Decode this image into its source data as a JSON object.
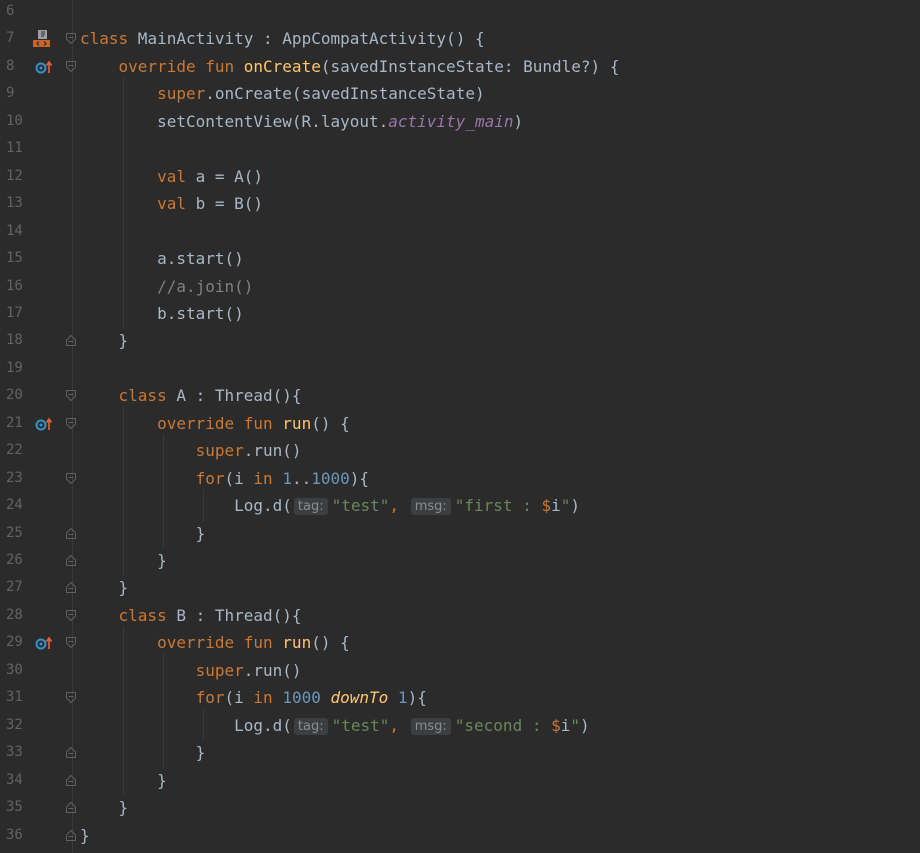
{
  "editor": {
    "colors": {
      "background": "#2b2b2b",
      "line_number": "#606366",
      "keyword": "#cc7832",
      "function_decl": "#ffc66d",
      "constant_italic": "#9876aa",
      "number": "#6897bb",
      "string": "#6a8759",
      "comment": "#808080",
      "default_text": "#a9b7c6"
    },
    "lines": [
      {
        "num": "6",
        "gutter": [],
        "segs": []
      },
      {
        "num": "7",
        "gutter": [
          "class-marker-icon",
          "fold-open-icon"
        ],
        "segs": [
          [
            "kw",
            "class"
          ],
          [
            "t",
            " MainActivity : AppCompatActivity() {"
          ]
        ]
      },
      {
        "num": "8",
        "gutter": [
          "override-icon",
          "fold-open-icon"
        ],
        "segs": [
          [
            "t",
            "    "
          ],
          [
            "kw",
            "override fun "
          ],
          [
            "fn",
            "onCreate"
          ],
          [
            "t",
            "(savedInstanceState: Bundle?) {"
          ]
        ]
      },
      {
        "num": "9",
        "gutter": [],
        "segs": [
          [
            "t",
            "        "
          ],
          [
            "kw",
            "super"
          ],
          [
            "t",
            ".onCreate(savedInstanceState)"
          ]
        ]
      },
      {
        "num": "10",
        "gutter": [],
        "segs": [
          [
            "t",
            "        setContentView(R.layout."
          ],
          [
            "ital",
            "activity_main"
          ],
          [
            "t",
            ")"
          ]
        ]
      },
      {
        "num": "11",
        "gutter": [],
        "segs": []
      },
      {
        "num": "12",
        "gutter": [],
        "segs": [
          [
            "t",
            "        "
          ],
          [
            "kw",
            "val"
          ],
          [
            "t",
            " a = A()"
          ]
        ]
      },
      {
        "num": "13",
        "gutter": [],
        "segs": [
          [
            "t",
            "        "
          ],
          [
            "kw",
            "val"
          ],
          [
            "t",
            " b = B()"
          ]
        ]
      },
      {
        "num": "14",
        "gutter": [],
        "segs": []
      },
      {
        "num": "15",
        "gutter": [],
        "segs": [
          [
            "t",
            "        a.start()"
          ]
        ]
      },
      {
        "num": "16",
        "gutter": [],
        "segs": [
          [
            "t",
            "        "
          ],
          [
            "cmt",
            "//a.join()"
          ]
        ]
      },
      {
        "num": "17",
        "gutter": [],
        "segs": [
          [
            "t",
            "        b.start()"
          ]
        ]
      },
      {
        "num": "18",
        "gutter": [
          "fold-close-icon"
        ],
        "segs": [
          [
            "t",
            "    }"
          ]
        ]
      },
      {
        "num": "19",
        "gutter": [],
        "segs": []
      },
      {
        "num": "20",
        "gutter": [
          "fold-open-icon"
        ],
        "segs": [
          [
            "t",
            "    "
          ],
          [
            "kw",
            "class"
          ],
          [
            "t",
            " A : Thread(){"
          ]
        ]
      },
      {
        "num": "21",
        "gutter": [
          "override-icon",
          "fold-open-icon"
        ],
        "segs": [
          [
            "t",
            "        "
          ],
          [
            "kw",
            "override fun "
          ],
          [
            "fn",
            "run"
          ],
          [
            "t",
            "() {"
          ]
        ]
      },
      {
        "num": "22",
        "gutter": [],
        "segs": [
          [
            "t",
            "            "
          ],
          [
            "kw",
            "super"
          ],
          [
            "t",
            ".run()"
          ]
        ]
      },
      {
        "num": "23",
        "gutter": [
          "fold-open-icon"
        ],
        "segs": [
          [
            "t",
            "            "
          ],
          [
            "kw",
            "for"
          ],
          [
            "t",
            "(i "
          ],
          [
            "kw",
            "in"
          ],
          [
            "t",
            " "
          ],
          [
            "num",
            "1"
          ],
          [
            "t",
            ".."
          ],
          [
            "num",
            "1000"
          ],
          [
            "t",
            "){"
          ]
        ]
      },
      {
        "num": "24",
        "gutter": [],
        "segs": [
          [
            "t",
            "                Log.d("
          ],
          [
            "hint",
            "tag:"
          ],
          [
            "str",
            "\"test\""
          ],
          [
            "kw",
            ", "
          ],
          [
            "hint",
            "msg:"
          ],
          [
            "str",
            "\"first : "
          ],
          [
            "dollar",
            "$"
          ],
          [
            "t",
            "i"
          ],
          [
            "str",
            "\""
          ],
          [
            "t",
            ")"
          ]
        ]
      },
      {
        "num": "25",
        "gutter": [
          "fold-close-icon"
        ],
        "segs": [
          [
            "t",
            "            }"
          ]
        ]
      },
      {
        "num": "26",
        "gutter": [
          "fold-close-icon"
        ],
        "segs": [
          [
            "t",
            "        }"
          ]
        ]
      },
      {
        "num": "27",
        "gutter": [
          "fold-close-icon"
        ],
        "segs": [
          [
            "t",
            "    }"
          ]
        ]
      },
      {
        "num": "28",
        "gutter": [
          "fold-open-icon"
        ],
        "segs": [
          [
            "t",
            "    "
          ],
          [
            "kw",
            "class"
          ],
          [
            "t",
            " B : Thread(){"
          ]
        ]
      },
      {
        "num": "29",
        "gutter": [
          "override-icon",
          "fold-open-icon"
        ],
        "segs": [
          [
            "t",
            "        "
          ],
          [
            "kw",
            "override fun "
          ],
          [
            "fn",
            "run"
          ],
          [
            "t",
            "() {"
          ]
        ]
      },
      {
        "num": "30",
        "gutter": [],
        "segs": [
          [
            "t",
            "            "
          ],
          [
            "kw",
            "super"
          ],
          [
            "t",
            ".run()"
          ]
        ]
      },
      {
        "num": "31",
        "gutter": [
          "fold-open-icon"
        ],
        "segs": [
          [
            "t",
            "            "
          ],
          [
            "kw",
            "for"
          ],
          [
            "t",
            "(i "
          ],
          [
            "kw",
            "in"
          ],
          [
            "t",
            " "
          ],
          [
            "num",
            "1000"
          ],
          [
            "t",
            " "
          ],
          [
            "ext",
            "downTo"
          ],
          [
            "t",
            " "
          ],
          [
            "num",
            "1"
          ],
          [
            "t",
            "){"
          ]
        ]
      },
      {
        "num": "32",
        "gutter": [],
        "segs": [
          [
            "t",
            "                Log.d("
          ],
          [
            "hint",
            "tag:"
          ],
          [
            "str",
            "\"test\""
          ],
          [
            "kw",
            ", "
          ],
          [
            "hint",
            "msg:"
          ],
          [
            "str",
            "\"second : "
          ],
          [
            "dollar",
            "$"
          ],
          [
            "t",
            "i"
          ],
          [
            "str",
            "\""
          ],
          [
            "t",
            ")"
          ]
        ]
      },
      {
        "num": "33",
        "gutter": [
          "fold-close-icon"
        ],
        "segs": [
          [
            "t",
            "            }"
          ]
        ]
      },
      {
        "num": "34",
        "gutter": [
          "fold-close-icon"
        ],
        "segs": [
          [
            "t",
            "        }"
          ]
        ]
      },
      {
        "num": "35",
        "gutter": [
          "fold-close-icon"
        ],
        "segs": [
          [
            "t",
            "    }"
          ]
        ]
      },
      {
        "num": "36",
        "gutter": [
          "fold-close-icon"
        ],
        "segs": [
          [
            "t",
            "}"
          ]
        ]
      }
    ]
  }
}
